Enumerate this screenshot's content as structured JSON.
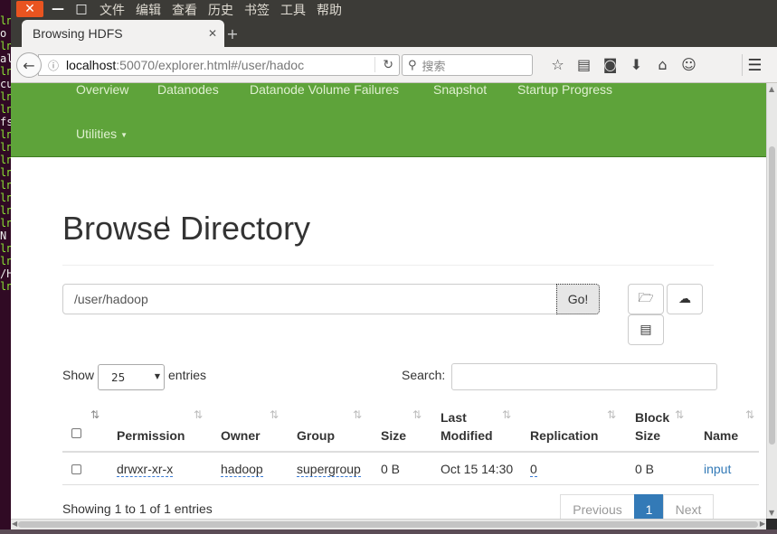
{
  "menubar": {
    "items": [
      "文件",
      "编辑",
      "查看",
      "历史",
      "书签",
      "工具",
      "帮助"
    ]
  },
  "tab": {
    "title": "Browsing HDFS"
  },
  "address": {
    "host": "localhost",
    "rest": ":50070/explorer.html#/user/hadoc"
  },
  "search": {
    "placeholder": "搜索"
  },
  "nav": {
    "items": [
      "Overview",
      "Datanodes",
      "Datanode Volume Failures",
      "Snapshot",
      "Startup Progress",
      "Utilities"
    ]
  },
  "page": {
    "title": "Browse Directory",
    "path_value": "/user/hadoop",
    "go_label": "Go!"
  },
  "table_controls": {
    "show_label": "Show",
    "entries_value": "25",
    "entries_label": "entries",
    "search_label": "Search:"
  },
  "table": {
    "headers": [
      "Permission",
      "Owner",
      "Group",
      "Size",
      "Last",
      "Modified",
      "Replication",
      "Block",
      "Size",
      "Name"
    ],
    "rows": [
      {
        "permission": "drwxr-xr-x",
        "owner": "hadoop",
        "group": "supergroup",
        "size": "0 B",
        "last_modified": "Oct 15 14:30",
        "replication": "0",
        "block_size": "0 B",
        "name": "input"
      }
    ]
  },
  "footer": {
    "info": "Showing 1 to 1 of 1 entries",
    "previous": "Previous",
    "page": "1",
    "next": "Next"
  },
  "terminal": {
    "lines": [
      "ln",
      "o",
      "ln",
      "al",
      "ln",
      "cu",
      "",
      "ln",
      "ln",
      "fs",
      "ln",
      "ln",
      "ln",
      "ln",
      "ln",
      "ln",
      "ln",
      "ln",
      "N",
      "ln",
      "ln",
      "",
      "/H",
      "ln",
      "",
      ""
    ]
  },
  "colors": {
    "nav_green": "#5ea33a",
    "link_blue": "#337ab7",
    "ubuntu_orange": "#e95420"
  }
}
